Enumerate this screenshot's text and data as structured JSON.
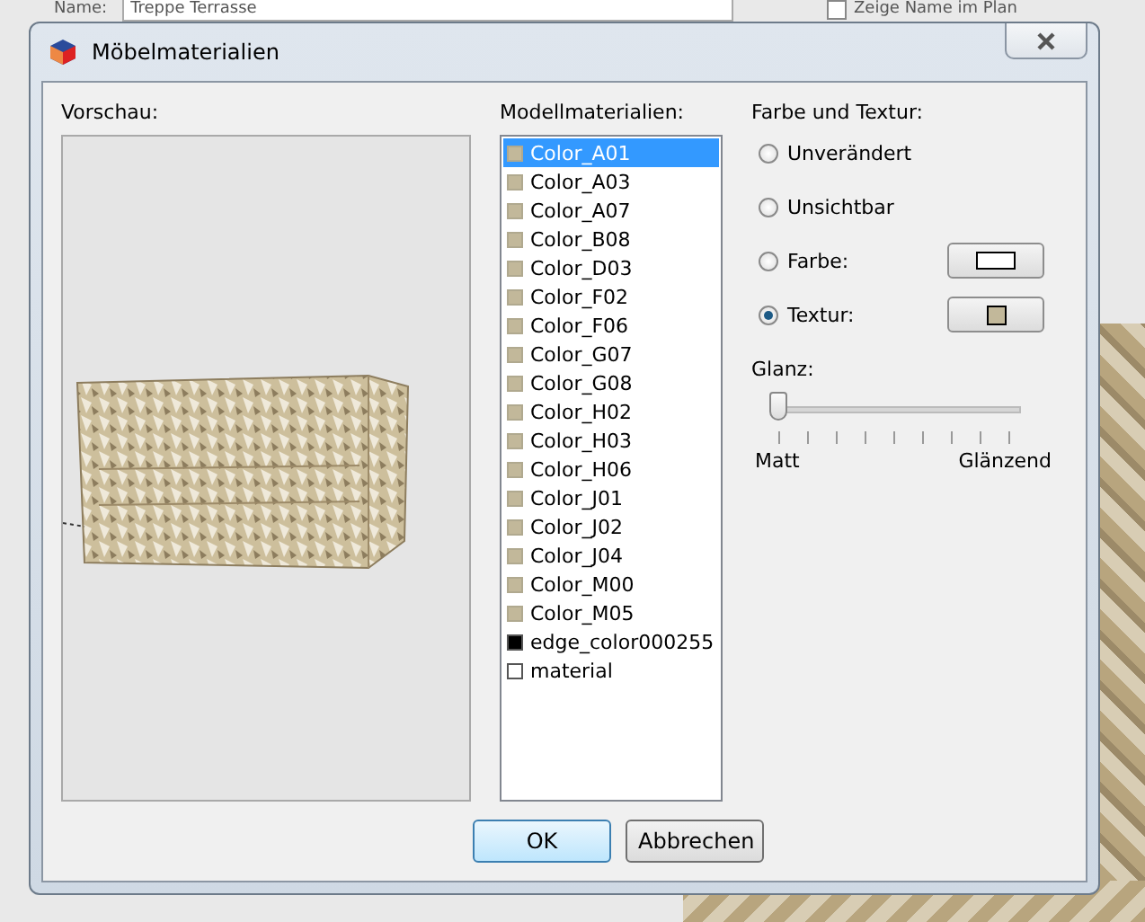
{
  "background_window": {
    "name_label": "Name:",
    "name_value": "Treppe Terrasse",
    "show_name_checkbox": {
      "label": "Zeige Name im Plan",
      "checked": false
    }
  },
  "window": {
    "title": "Möbelmaterialien"
  },
  "preview": {
    "label": "Vorschau:"
  },
  "materials": {
    "label": "Modellmaterialien:",
    "items": [
      {
        "name": "Color_A01",
        "color": "#c2b89a",
        "selected": true
      },
      {
        "name": "Color_A03",
        "color": "#c2b89a",
        "selected": false
      },
      {
        "name": "Color_A07",
        "color": "#c2b89a",
        "selected": false
      },
      {
        "name": "Color_B08",
        "color": "#c2b89a",
        "selected": false
      },
      {
        "name": "Color_D03",
        "color": "#c2b89a",
        "selected": false
      },
      {
        "name": "Color_F02",
        "color": "#c2b89a",
        "selected": false
      },
      {
        "name": "Color_F06",
        "color": "#c2b89a",
        "selected": false
      },
      {
        "name": "Color_G07",
        "color": "#c2b89a",
        "selected": false
      },
      {
        "name": "Color_G08",
        "color": "#c2b89a",
        "selected": false
      },
      {
        "name": "Color_H02",
        "color": "#c2b89a",
        "selected": false
      },
      {
        "name": "Color_H03",
        "color": "#c2b89a",
        "selected": false
      },
      {
        "name": "Color_H06",
        "color": "#c2b89a",
        "selected": false
      },
      {
        "name": "Color_J01",
        "color": "#c2b89a",
        "selected": false
      },
      {
        "name": "Color_J02",
        "color": "#c2b89a",
        "selected": false
      },
      {
        "name": "Color_J04",
        "color": "#c2b89a",
        "selected": false
      },
      {
        "name": "Color_M00",
        "color": "#c2b89a",
        "selected": false
      },
      {
        "name": "Color_M05",
        "color": "#c2b89a",
        "selected": false
      },
      {
        "name": "edge_color000255",
        "color": "#000000",
        "selected": false
      },
      {
        "name": "material",
        "color": "#ffffff",
        "selected": false
      }
    ]
  },
  "color_texture": {
    "label": "Farbe und Textur:",
    "options": [
      {
        "label": "Unverändert",
        "selected": false,
        "kind": "plain"
      },
      {
        "label": "Unsichtbar",
        "selected": false,
        "kind": "plain"
      },
      {
        "label": "Farbe:",
        "selected": false,
        "kind": "color"
      },
      {
        "label": "Textur:",
        "selected": true,
        "kind": "texture"
      }
    ]
  },
  "gloss": {
    "label": "Glanz:",
    "level": 0,
    "min_label": "Matt",
    "max_label": "Glänzend"
  },
  "buttons": [
    {
      "label": "OK",
      "default": true
    },
    {
      "label": "Abbrechen",
      "default": false
    }
  ]
}
